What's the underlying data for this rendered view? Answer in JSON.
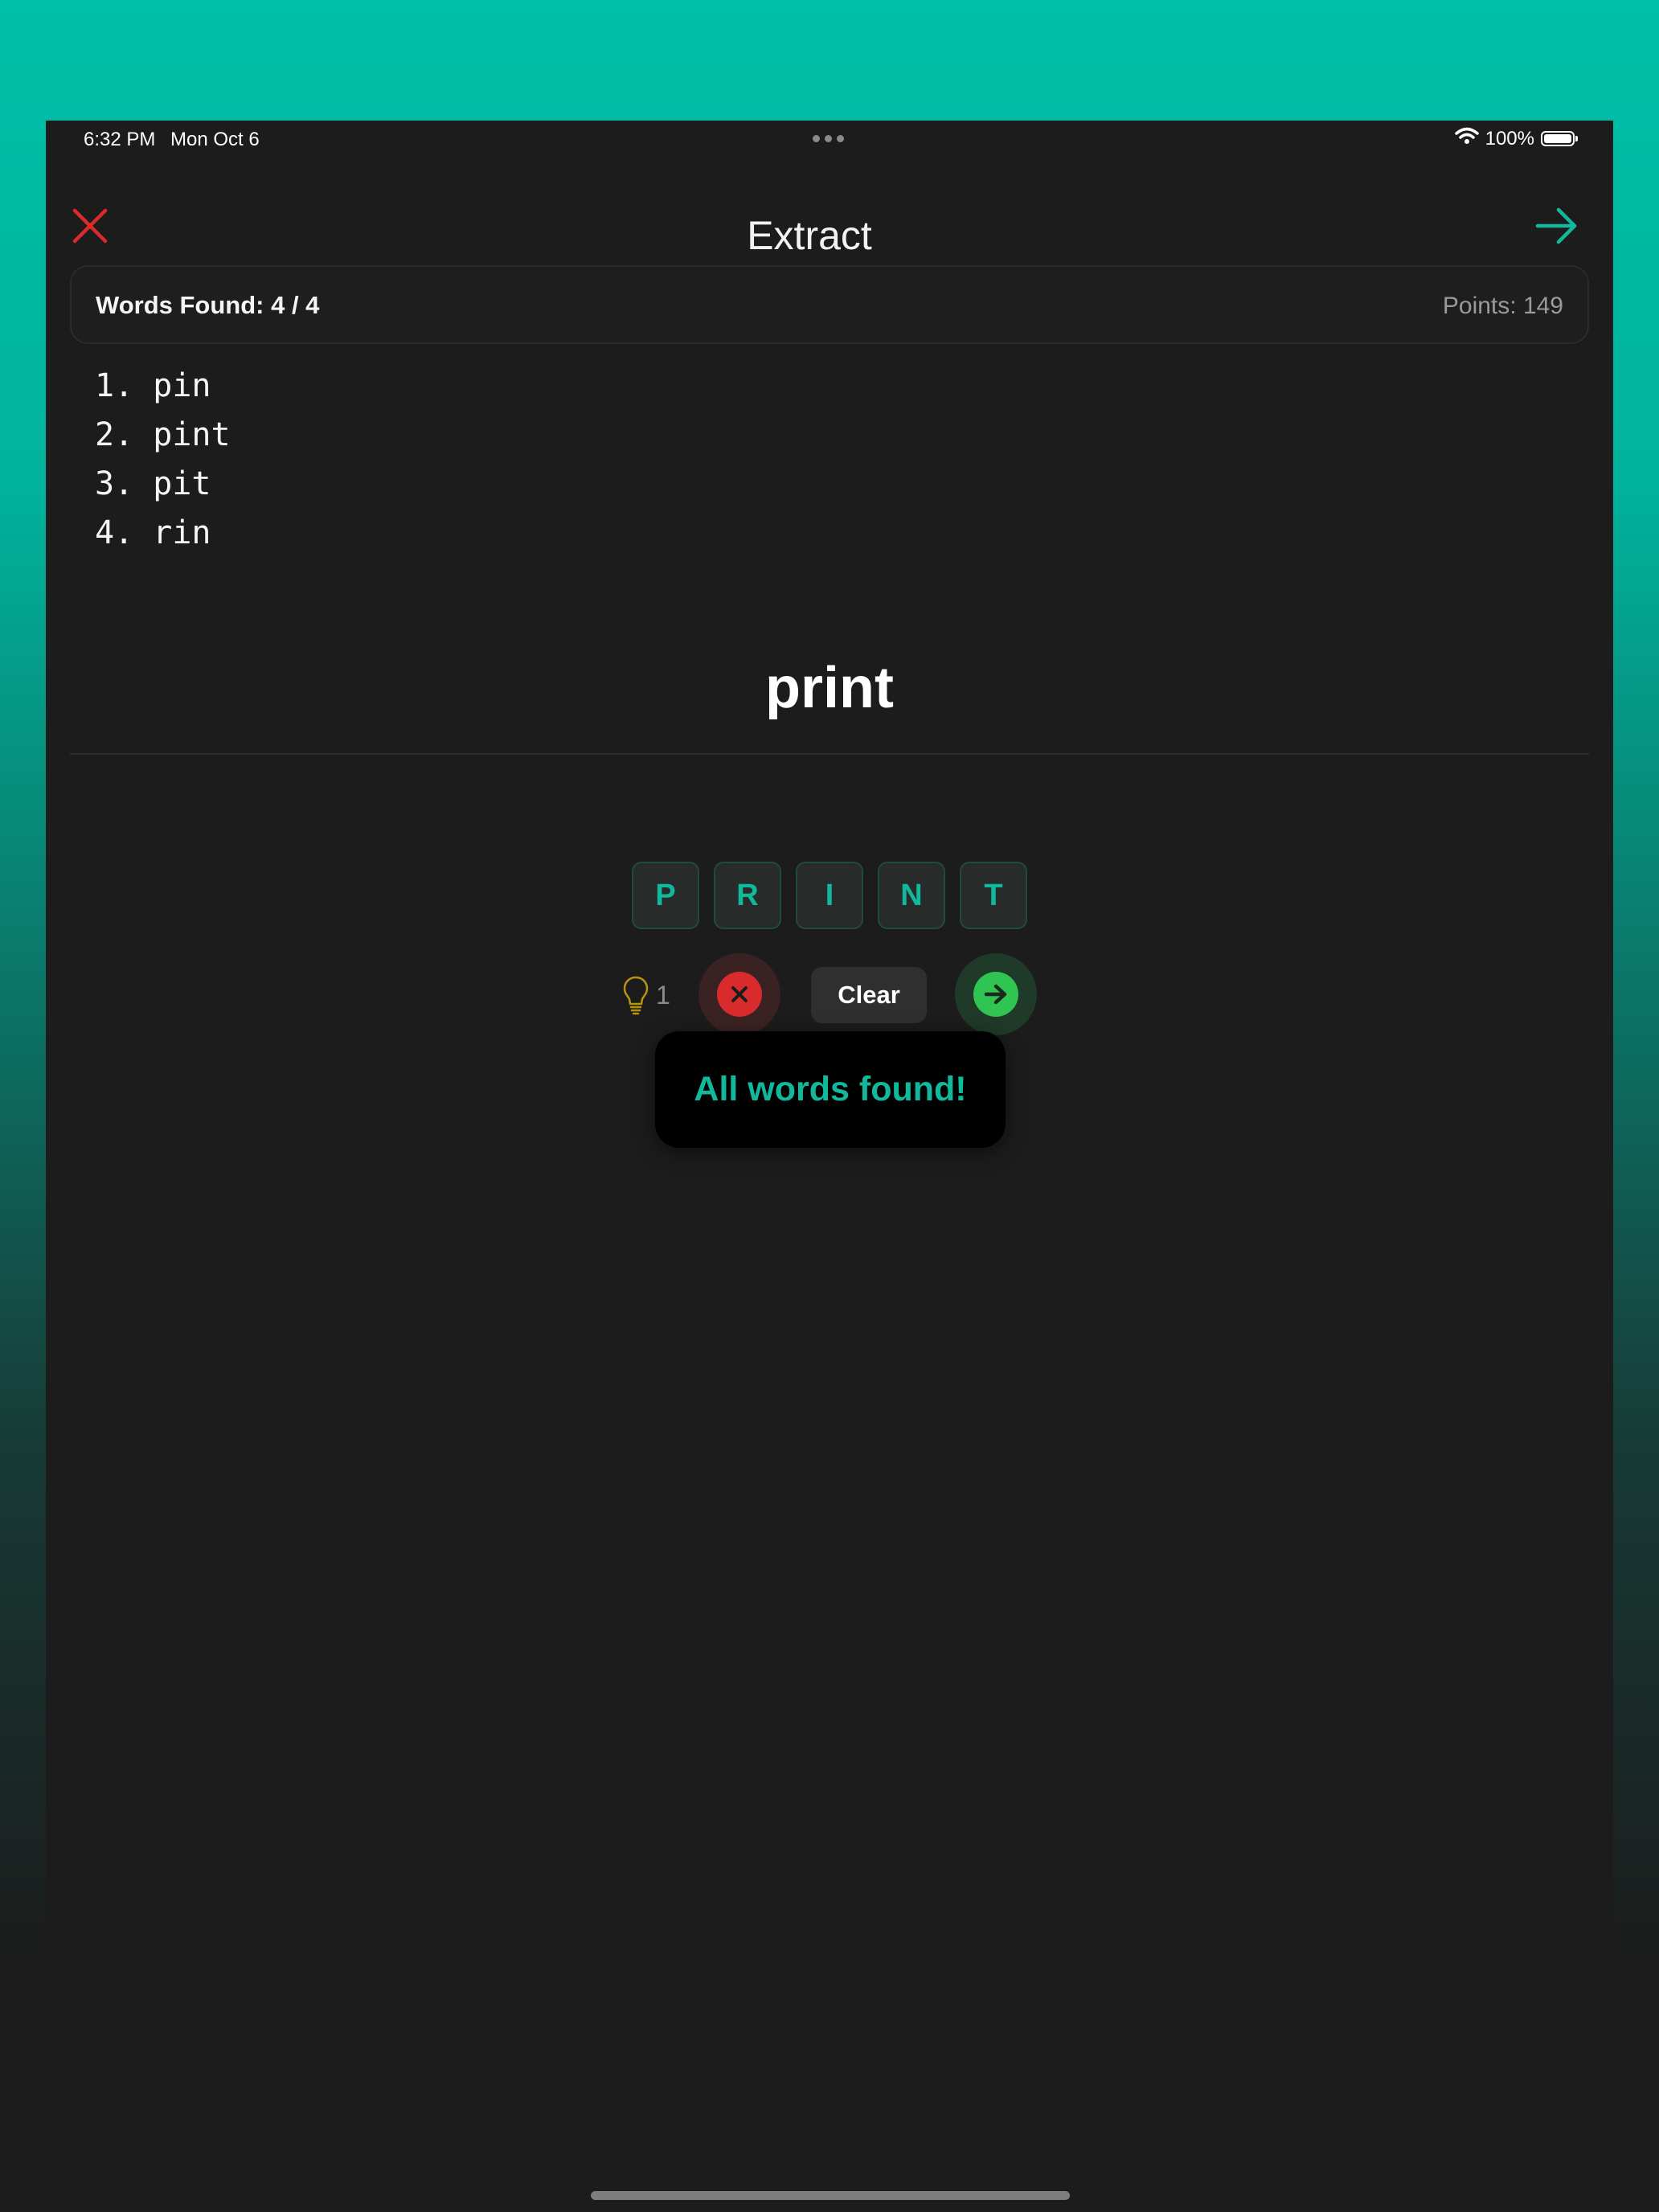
{
  "status_bar": {
    "time": "6:32 PM",
    "date": "Mon Oct 6",
    "battery": "100%",
    "battery_level": 1.0,
    "wifi_icon": "wifi-icon",
    "battery_icon": "battery-icon"
  },
  "nav": {
    "title": "Extract",
    "close_icon": "close-icon",
    "next_icon": "arrow-right-icon"
  },
  "stats": {
    "words_found": "Words Found: 4 / 4",
    "points": "Points: 149"
  },
  "found_words": [
    "1. pin",
    "2. pint",
    "3. pit",
    "4. rin"
  ],
  "current_word": "print",
  "tiles": [
    "P",
    "R",
    "I",
    "N",
    "T"
  ],
  "controls": {
    "hint_icon": "lightbulb-icon",
    "hint_count": "1",
    "delete_icon": "x-circle-icon",
    "clear_label": "Clear",
    "submit_icon": "arrow-circle-right-icon"
  },
  "toast": {
    "message": "All words found!"
  },
  "colors": {
    "accent": "#12b89c",
    "danger": "#d92b2b",
    "success": "#30c452",
    "background": "#1c1c1c",
    "hint": "#b8930f"
  }
}
